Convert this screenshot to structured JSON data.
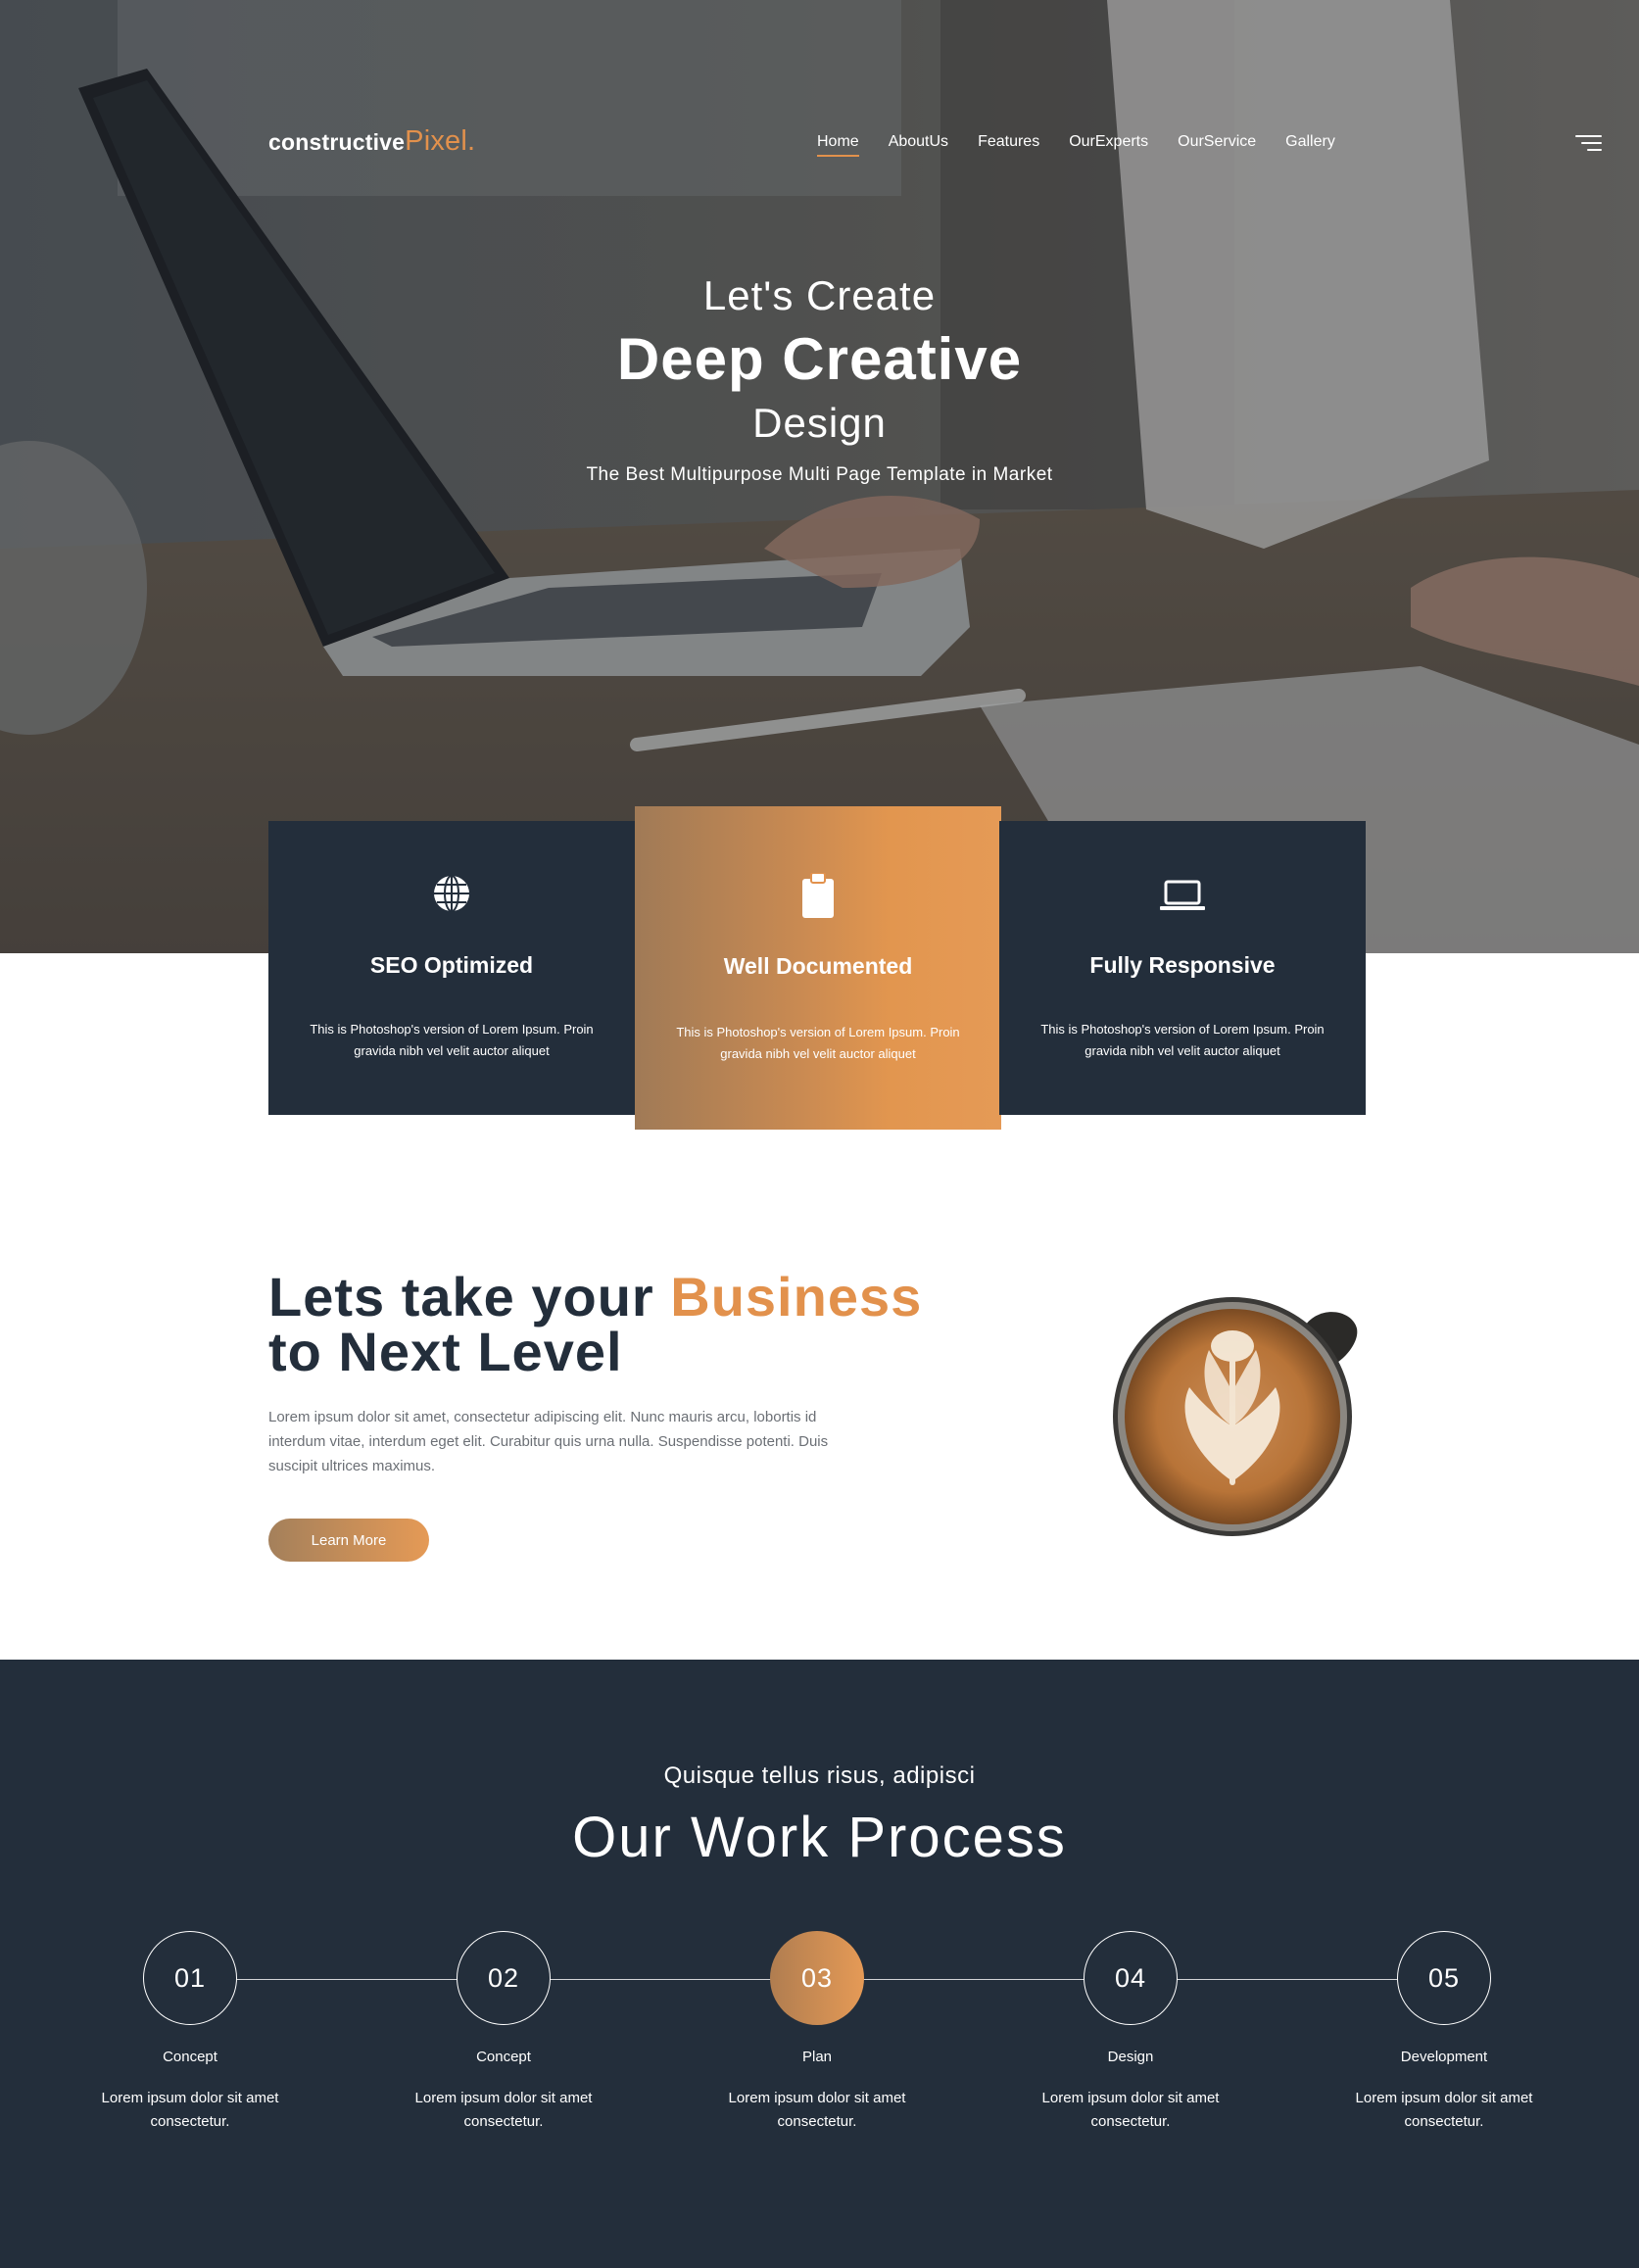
{
  "nav": {
    "logo_main": "constructive",
    "logo_accent": "Pixel.",
    "links": [
      {
        "label": "Home",
        "active": true
      },
      {
        "label": "AboutUs"
      },
      {
        "label": "Features"
      },
      {
        "label": "OurExperts"
      },
      {
        "label": "OurService"
      },
      {
        "label": "Gallery"
      }
    ],
    "menu_icon": "hamburger-menu-icon"
  },
  "hero": {
    "line1": "Let's Create",
    "line2": "Deep Creative",
    "line3": "Design",
    "tagline": "The Best Multipurpose Multi Page Template in Market"
  },
  "features": [
    {
      "icon": "globe-icon",
      "title": "SEO Optimized",
      "text": "This is Photoshop's version of Lorem Ipsum. Proin gravida nibh vel velit auctor aliquet"
    },
    {
      "icon": "clipboard-icon",
      "title": "Well Documented",
      "text": "This is Photoshop's version of Lorem Ipsum. Proin gravida nibh vel velit auctor aliquet"
    },
    {
      "icon": "laptop-icon",
      "title": "Fully Responsive",
      "text": "This is Photoshop's version of Lorem Ipsum. Proin gravida nibh vel velit auctor aliquet"
    }
  ],
  "business": {
    "title_part1": "Lets take your ",
    "title_accent": "Business",
    "title_part2": "to Next Level",
    "text": "Lorem ipsum dolor sit amet, consectetur adipiscing elit. Nunc mauris arcu, lobortis id interdum vitae, interdum eget elit. Curabitur quis urna nulla. Suspendisse potenti. Duis suscipit ultrices maximus.",
    "button": "Learn More"
  },
  "process": {
    "subtitle": "Quisque tellus risus, adipisci",
    "title": "Our Work Process",
    "steps": [
      {
        "number": "01",
        "label": "Concept",
        "desc": "Lorem ipsum dolor sit amet consectetur."
      },
      {
        "number": "02",
        "label": "Concept",
        "desc": "Lorem ipsum dolor sit amet consectetur."
      },
      {
        "number": "03",
        "label": "Plan",
        "desc": "Lorem ipsum dolor sit amet consectetur.",
        "active": true
      },
      {
        "number": "04",
        "label": "Design",
        "desc": "Lorem ipsum dolor sit amet consectetur."
      },
      {
        "number": "05",
        "label": "Development",
        "desc": "Lorem ipsum dolor sit amet consectetur."
      }
    ]
  },
  "colors": {
    "accent": "#e2914c",
    "dark": "#232e3b"
  }
}
